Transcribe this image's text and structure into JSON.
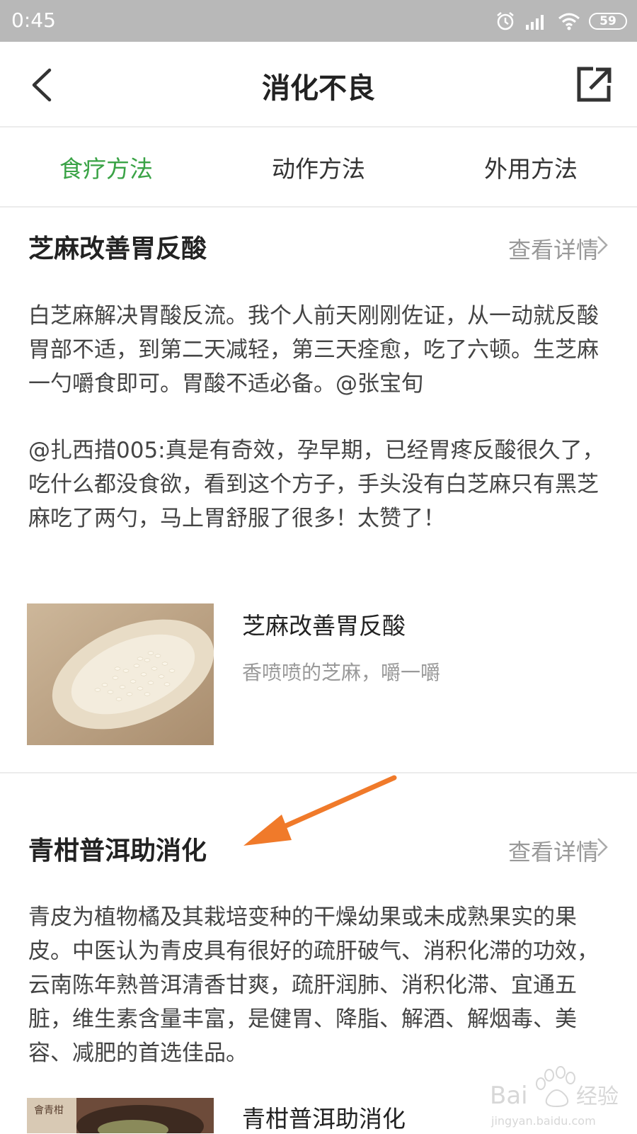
{
  "status_bar": {
    "time": "0:45",
    "battery": "59"
  },
  "nav": {
    "title": "消化不良"
  },
  "tabs": [
    {
      "label": "食疗方法",
      "active": true
    },
    {
      "label": "动作方法",
      "active": false
    },
    {
      "label": "外用方法",
      "active": false
    }
  ],
  "cards": [
    {
      "title": "芝麻改善胃反酸",
      "detail_link": "查看详情",
      "paragraphs": [
        "白芝麻解决胃酸反流。我个人前天刚刚佐证，从一动就反酸胃部不适，到第二天减轻，第三天痊愈，吃了六顿。生芝麻一勺嚼食即可。胃酸不适必备。@张宝旬",
        "@扎西措005:真是有奇效，孕早期，已经胃疼反酸很久了，吃什么都没食欲，看到这个方子，手头没有白芝麻只有黑芝麻吃了两勺，马上胃舒服了很多！太赞了！"
      ],
      "recommendation": {
        "title": "芝麻改善胃反酸",
        "subtitle": "香喷喷的芝麻，嚼一嚼"
      }
    },
    {
      "title": "青柑普洱助消化",
      "detail_link": "查看详情",
      "paragraphs": [
        "青皮为植物橘及其栽培变种的干燥幼果或未成熟果实的果皮。中医认为青皮具有很好的疏肝破气、消积化滞的功效，云南陈年熟普洱清香甘爽，疏肝润肺、消积化滞、宜通五脏，维生素含量丰富，是健胃、降脂、解酒、解烟毒、美容、减肥的首选佳品。"
      ],
      "recommendation": {
        "title": "青柑普洱助消化",
        "thumb_text": "會青柑"
      }
    }
  ],
  "watermark": {
    "brand": "Bai",
    "brand_cn": "经验",
    "url": "jingyan.baidu.com"
  },
  "colors": {
    "accent_green": "#3aa346",
    "annotation_orange": "#f07a2a",
    "status_bar": "#b8b8b8"
  }
}
